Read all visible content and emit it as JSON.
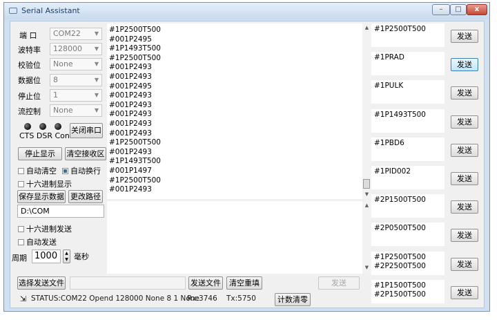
{
  "window": {
    "title": "Serial Assistant",
    "minimize_icon": "minimize-icon",
    "maximize_icon": "maximize-icon",
    "close_icon": "close-icon"
  },
  "settings": {
    "port": {
      "label": "端 口",
      "value": "COM22"
    },
    "baud": {
      "label": "波特率",
      "value": "128000"
    },
    "parity": {
      "label": "校验位",
      "value": "None"
    },
    "databits": {
      "label": "数据位",
      "value": "8"
    },
    "stopbits": {
      "label": "停止位",
      "value": "1"
    },
    "flow": {
      "label": "流控制",
      "value": "None"
    }
  },
  "indicators": {
    "label": "CTS DSR Conn",
    "close_port": "关闭串口"
  },
  "receive": {
    "stop_display": "停止显示",
    "clear_receive": "清空接收区",
    "auto_clear": {
      "label": "自动清空",
      "checked": false
    },
    "auto_wrap": {
      "label": "自动换行",
      "checked": true
    },
    "hex_display": {
      "label": "十六进制显示",
      "checked": false
    },
    "save_data": "保存显示数据",
    "change_path": "更改路径",
    "path": "D:\\COM",
    "lines": [
      "#1P2500T500",
      "#001P2495",
      "#1P1493T500",
      "#1P2500T500",
      "#001P2493",
      "#001P2493",
      "#001P2495",
      "#001P2493",
      "#001P2493",
      "#001P2493",
      "#001P2493",
      "#001P2493",
      "#1P2500T500",
      "#001P2493",
      "#1P1493T500",
      "#001P1497",
      "#1P2500T500",
      "#001P2493"
    ]
  },
  "send": {
    "hex_send": {
      "label": "十六进制发送",
      "checked": false
    },
    "auto_send": {
      "label": "自动发送",
      "checked": false
    },
    "period_label": "周期",
    "period_value": "1000",
    "period_unit": "毫秒",
    "select_file": "选择发送文件",
    "send_file": "发送文件",
    "clear_resend": "清空重填",
    "send": "发送",
    "count_reset": "计数清零"
  },
  "status": {
    "text": "STATUS:COM22 Opend 128000 None 8 1 None",
    "rx": "Rx:3746",
    "tx": "Tx:5750",
    "icon": "plug-icon"
  },
  "commands": [
    {
      "text": "#1P2500T500",
      "button": "发送"
    },
    {
      "text": "#1PRAD",
      "button": "发送"
    },
    {
      "text": "#1PULK",
      "button": "发送"
    },
    {
      "text": "#1P1493T500",
      "button": "发送"
    },
    {
      "text": "#1PBD6",
      "button": "发送"
    },
    {
      "text": "#1PID002",
      "button": "发送"
    },
    {
      "text": "#2P1500T500",
      "button": "发送"
    },
    {
      "text": "#2P0500T500",
      "button": "发送"
    },
    {
      "text": "#1P2500T500\n#2P2500T500",
      "button": "发送"
    },
    {
      "text": "#1P1500T500\n#2P1500T500",
      "button": "发送"
    }
  ]
}
